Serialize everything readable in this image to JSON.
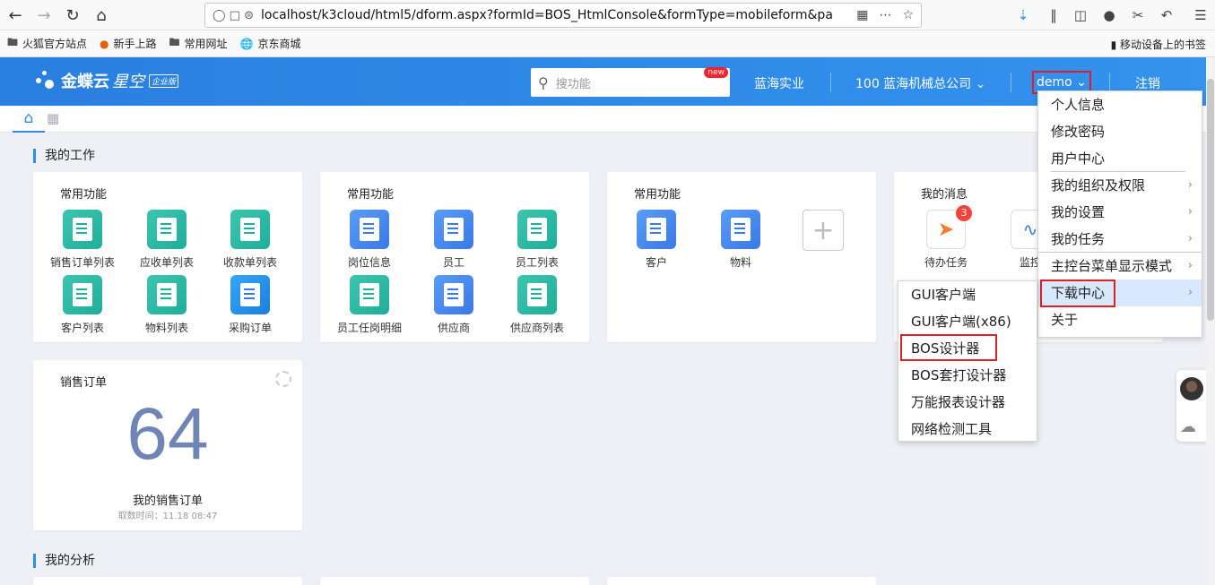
{
  "browser": {
    "url": "localhost/k3cloud/html5/dform.aspx?formId=BOS_HtmlConsole&formType=mobileform&pa",
    "bookmarks": [
      "火狐官方站点",
      "新手上路",
      "常用网址",
      "京东商城"
    ],
    "mobile_bookmarks": "移动设备上的书签"
  },
  "app": {
    "logo_text": "金蝶云",
    "logo_sub": "星空",
    "logo_badge": "企业版",
    "search_placeholder": "搜功能",
    "search_badge": "new",
    "org": "蓝海实业",
    "company": "100 蓝海机械总公司",
    "user": "demo",
    "logout": "注销"
  },
  "sections": {
    "work": "我的工作",
    "analysis": "我的分析"
  },
  "cards": [
    {
      "title": "常用功能",
      "tiles": [
        "销售订单列表",
        "应收单列表",
        "收款单列表",
        "客户列表",
        "物料列表",
        "采购订单"
      ]
    },
    {
      "title": "常用功能",
      "tiles": [
        "岗位信息",
        "员工",
        "员工列表",
        "员工任岗明细",
        "供应商",
        "供应商列表"
      ]
    },
    {
      "title": "常用功能",
      "tiles": [
        "客户",
        "物料"
      ]
    },
    {
      "title": "我的消息",
      "tiles": [
        "待办任务",
        "监控"
      ],
      "badge": "3"
    }
  ],
  "sales": {
    "title": "销售订单",
    "value": "64",
    "label": "我的销售订单",
    "fetch_time": "取数时间：11.18 08:47"
  },
  "user_menu": [
    "个人信息",
    "修改密码",
    "用户中心",
    "我的组织及权限",
    "我的设置",
    "我的任务",
    "主控台菜单显示模式",
    "下载中心",
    "关于"
  ],
  "download_menu": [
    "GUI客户端",
    "GUI客户端(x86)",
    "BOS设计器",
    "BOS套打设计器",
    "万能报表设计器",
    "网络检测工具"
  ]
}
